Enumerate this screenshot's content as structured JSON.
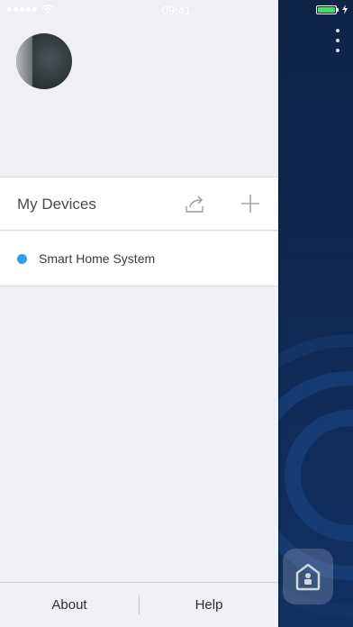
{
  "status_bar": {
    "time": "09:41"
  },
  "drawer": {
    "devices_header": {
      "title": "My Devices"
    },
    "devices": [
      {
        "name": "Smart Home System",
        "status_color": "#2e9ee8"
      }
    ],
    "footer": {
      "about_label": "About",
      "help_label": "Help"
    }
  },
  "colors": {
    "drawer_bg": "#efeff4",
    "panel_bg": "#102447",
    "accent": "#2e9ee8",
    "battery": "#4cd964"
  },
  "icons": {
    "share": "share-icon",
    "add": "plus-icon",
    "more": "kebab-menu-icon",
    "home": "home-icon"
  }
}
